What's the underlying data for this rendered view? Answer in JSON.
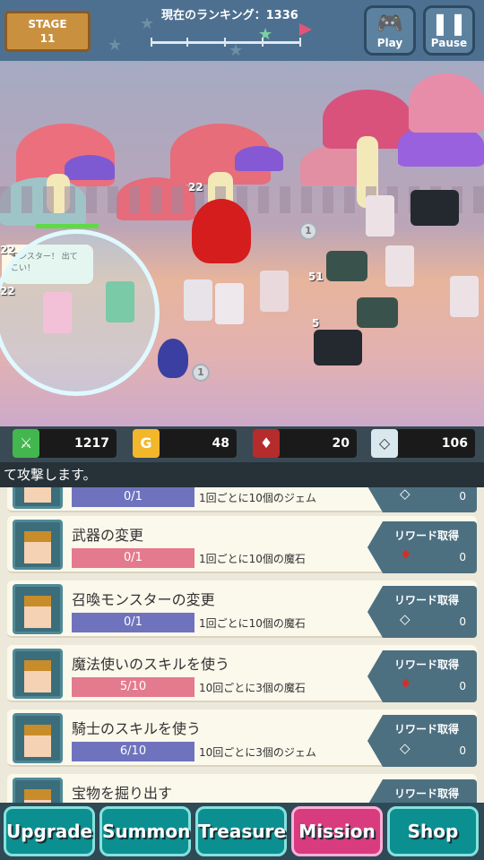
{
  "game": {
    "stage_label": "STAGE",
    "stage_number": "11",
    "ranking_text": "現在のランキング：1336",
    "play_button": "Play",
    "pause_button": "Pause"
  },
  "battle": {
    "speech_text": "モンスター！\n出てこい！",
    "hp_labels": [
      "22",
      "22",
      "22",
      "51",
      "5"
    ],
    "coin_text": "1"
  },
  "resources": [
    {
      "icon": "sword-icon",
      "value": "1217",
      "color": "#43b64d"
    },
    {
      "icon": "gold-icon",
      "value": "48",
      "color": "#f3b72b"
    },
    {
      "icon": "ruby-icon",
      "value": "20",
      "color": "#b52c2c"
    },
    {
      "icon": "diamond-icon",
      "value": "106",
      "color": "#d8e8ec"
    }
  ],
  "ticker": "て攻撃します。",
  "missions": [
    {
      "title": "",
      "progress": "0/1",
      "desc": "1回ごとに10個のジェム",
      "bar_color": "#6f73bd",
      "reward_label": "",
      "reward_value": "0",
      "reward_icon": "diamond-icon"
    },
    {
      "title": "武器の変更",
      "progress": "0/1",
      "desc": "1回ごとに10個の魔石",
      "bar_color": "#e47a8e",
      "reward_label": "リワード取得",
      "reward_value": "0",
      "reward_icon": "ruby-icon"
    },
    {
      "title": "召喚モンスターの変更",
      "progress": "0/1",
      "desc": "1回ごとに10個の魔石",
      "bar_color": "#6f73bd",
      "reward_label": "リワード取得",
      "reward_value": "0",
      "reward_icon": "diamond-icon"
    },
    {
      "title": "魔法使いのスキルを使う",
      "progress": "5/10",
      "desc": "10回ごとに3個の魔石",
      "bar_color": "#e47a8e",
      "reward_label": "リワード取得",
      "reward_value": "0",
      "reward_icon": "ruby-icon"
    },
    {
      "title": "騎士のスキルを使う",
      "progress": "6/10",
      "desc": "10回ごとに3個のジェム",
      "bar_color": "#6f73bd",
      "reward_label": "リワード取得",
      "reward_value": "0",
      "reward_icon": "diamond-icon"
    },
    {
      "title": "宝物を掘り出す",
      "progress": "",
      "desc": "",
      "bar_color": "#6f73bd",
      "reward_label": "リワード取得",
      "reward_value": "",
      "reward_icon": ""
    }
  ],
  "tabs": [
    "Upgrade",
    "Summon",
    "Treasure",
    "Mission",
    "Shop"
  ],
  "active_tab": "Mission"
}
